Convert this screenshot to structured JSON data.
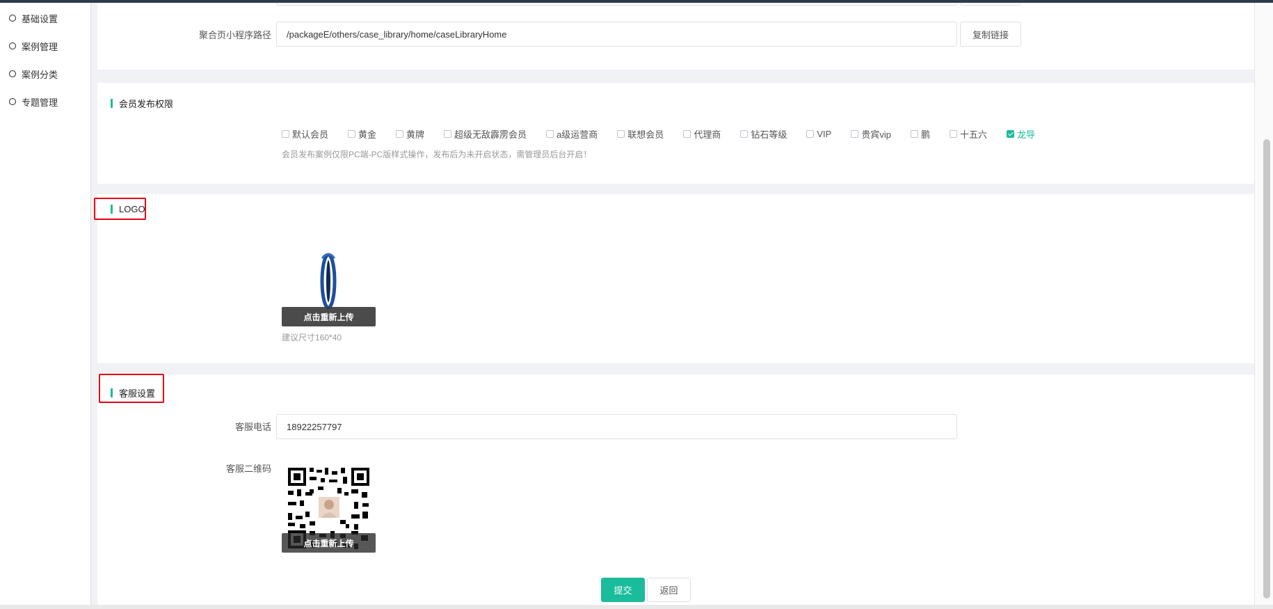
{
  "sidebar": {
    "items": [
      {
        "label": "基础设置"
      },
      {
        "label": "案例管理"
      },
      {
        "label": "案例分类"
      },
      {
        "label": "专题管理"
      }
    ]
  },
  "aggregate": {
    "label": "聚合页小程序路径",
    "value": "/packageE/others/case_library/home/caseLibraryHome",
    "copy_label": "复制链接"
  },
  "member_permission": {
    "title": "会员发布权限",
    "options": [
      {
        "label": "默认会员",
        "checked": false
      },
      {
        "label": "黄金",
        "checked": false
      },
      {
        "label": "黄牌",
        "checked": false
      },
      {
        "label": "超级无敌霹雳会员",
        "checked": false
      },
      {
        "label": "a级运营商",
        "checked": false
      },
      {
        "label": "联想会员",
        "checked": false
      },
      {
        "label": "代理商",
        "checked": false
      },
      {
        "label": "钻石等级",
        "checked": false
      },
      {
        "label": "VIP",
        "checked": false
      },
      {
        "label": "贵宾vip",
        "checked": false
      },
      {
        "label": "鹏",
        "checked": false
      },
      {
        "label": "十五六",
        "checked": false
      },
      {
        "label": "龙导",
        "checked": true
      }
    ],
    "hint": "会员发布案例仅限PC端-PC版样式操作，发布后为未开启状态，需管理员后台开启！"
  },
  "logo": {
    "title": "LOGO",
    "upload_label": "点击重新上传",
    "size_hint": "建议尺寸160*40"
  },
  "customer_service": {
    "title": "客服设置",
    "phone_label": "客服电话",
    "phone_value": "18922257797",
    "qr_label": "客服二维码",
    "qr_upload_label": "点击重新上传"
  },
  "actions": {
    "submit_label": "提交",
    "back_label": "返回"
  },
  "colors": {
    "accent": "#1abc9c",
    "highlight_border": "#e60012"
  }
}
